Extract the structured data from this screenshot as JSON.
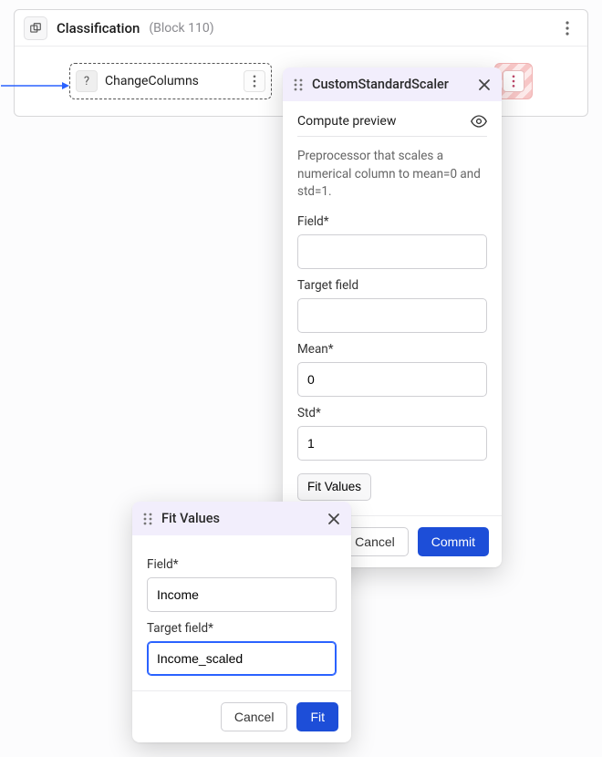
{
  "pipeline": {
    "title": "Classification",
    "subtitle": "(Block 110)"
  },
  "nodes": {
    "change_columns": {
      "icon": "?",
      "label": "ChangeColumns"
    }
  },
  "scaler_popover": {
    "title": "CustomStandardScaler",
    "preview_label": "Compute preview",
    "description": "Preprocessor that scales a numerical column to mean=0 and std=1.",
    "field_label": "Field*",
    "field_value": "",
    "target_label": "Target field",
    "target_value": "",
    "mean_label": "Mean*",
    "mean_value": "0",
    "std_label": "Std*",
    "std_value": "1",
    "fit_values_btn": "Fit Values",
    "cancel": "Cancel",
    "commit": "Commit"
  },
  "fit_popover": {
    "title": "Fit Values",
    "field_label": "Field*",
    "field_value": "Income",
    "target_label": "Target field*",
    "target_value": "Income_scaled",
    "cancel": "Cancel",
    "fit": "Fit"
  }
}
